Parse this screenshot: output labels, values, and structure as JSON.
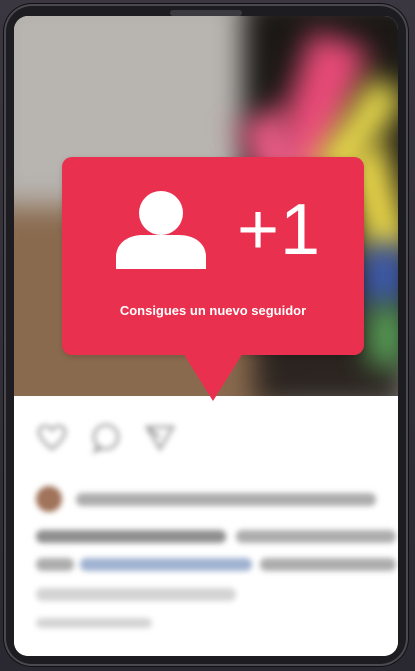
{
  "notification": {
    "count_text": "+1",
    "message": "Consigues un nuevo seguidor",
    "icon": "user-icon",
    "color": "#e9304f"
  },
  "post": {
    "actions": [
      "heart-icon",
      "comment-icon",
      "send-icon"
    ]
  }
}
